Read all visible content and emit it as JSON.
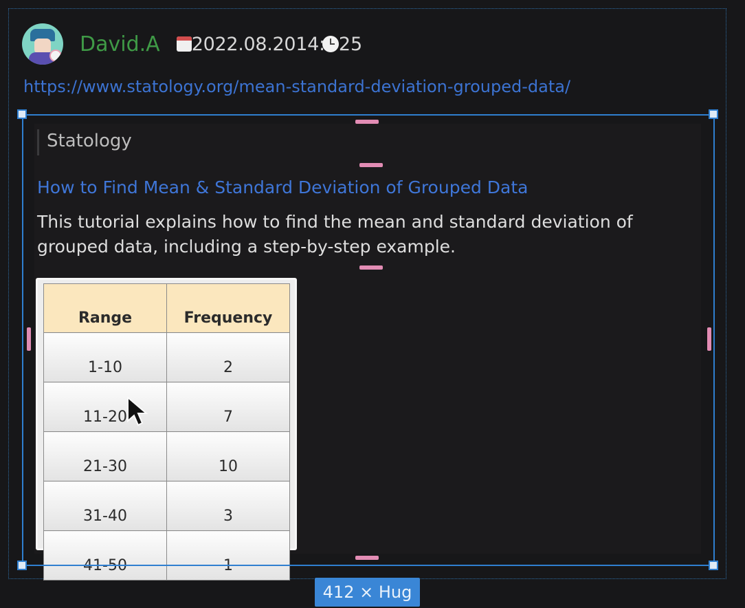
{
  "post": {
    "username": "David.A",
    "date": "2022.08.2014:",
    "time": "25",
    "url": "https://www.statology.org/mean-standard-deviation-grouped-data/"
  },
  "embed": {
    "site_name": "Statology",
    "title": "How to Find Mean & Standard Deviation of Grouped Data",
    "description": "This tutorial explains how to find the mean and standard deviation of grouped data, including a step-by-step example."
  },
  "table": {
    "headers": [
      "Range",
      "Frequency"
    ],
    "rows": [
      [
        "1-10",
        "2"
      ],
      [
        "11-20",
        "7"
      ],
      [
        "21-30",
        "10"
      ],
      [
        "31-40",
        "3"
      ],
      [
        "41-50",
        "1"
      ]
    ]
  },
  "size_label": "412 × Hug",
  "icons": {
    "calendar": "calendar-icon",
    "clock": "clock-icon",
    "cursor": "mouse-cursor-icon"
  }
}
